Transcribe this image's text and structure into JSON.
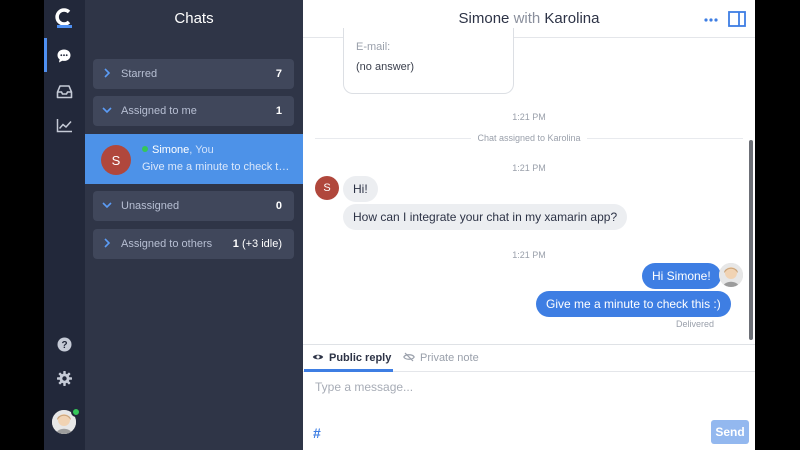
{
  "rail": {
    "logo_icon": "c-logo-icon",
    "items": [
      {
        "icon": "chat-icon",
        "active": true
      },
      {
        "icon": "inbox-icon"
      },
      {
        "icon": "reports-chart-icon"
      },
      {
        "icon": "help-icon"
      },
      {
        "icon": "settings-gear-icon"
      }
    ],
    "user_status": "online"
  },
  "chat_list": {
    "title": "Chats",
    "groups": [
      {
        "label": "Starred",
        "count": "7",
        "expanded": false
      },
      {
        "label": "Assigned to me",
        "count": "1",
        "expanded": true
      },
      {
        "label": "Unassigned",
        "count": "0",
        "expanded": true
      },
      {
        "label": "Assigned to others",
        "count": "1",
        "idle": "(+3 idle)",
        "expanded": false
      }
    ],
    "active_chat": {
      "initial": "S",
      "name": "Simone",
      "suffix": ", You",
      "preview": "Give me a minute to check this :)"
    }
  },
  "conversation": {
    "header": {
      "customer": "Simone",
      "with_word": "with",
      "agent": "Karolina"
    },
    "form": {
      "label": "E-mail:",
      "value": "(no answer)"
    },
    "time_1": "1:21 PM",
    "system_message": "Chat assigned to Karolina",
    "time_2": "1:21 PM",
    "customer_initial": "S",
    "customer_messages": [
      "Hi!",
      "How can I integrate your chat in my xamarin app?"
    ],
    "time_3": "1:21 PM",
    "agent_messages": [
      "Hi Simone!",
      "Give me a minute to check this :)"
    ],
    "delivery_status": "Delivered"
  },
  "composer": {
    "tab_public": "Public reply",
    "tab_private": "Private note",
    "placeholder": "Type a message...",
    "hash": "#",
    "send_label": "Send"
  },
  "colors": {
    "rail_bg": "#22283a",
    "list_bg": "#2f3547",
    "accent": "#3e7ee3",
    "active_row": "#4d92e8",
    "online": "#35c759"
  }
}
